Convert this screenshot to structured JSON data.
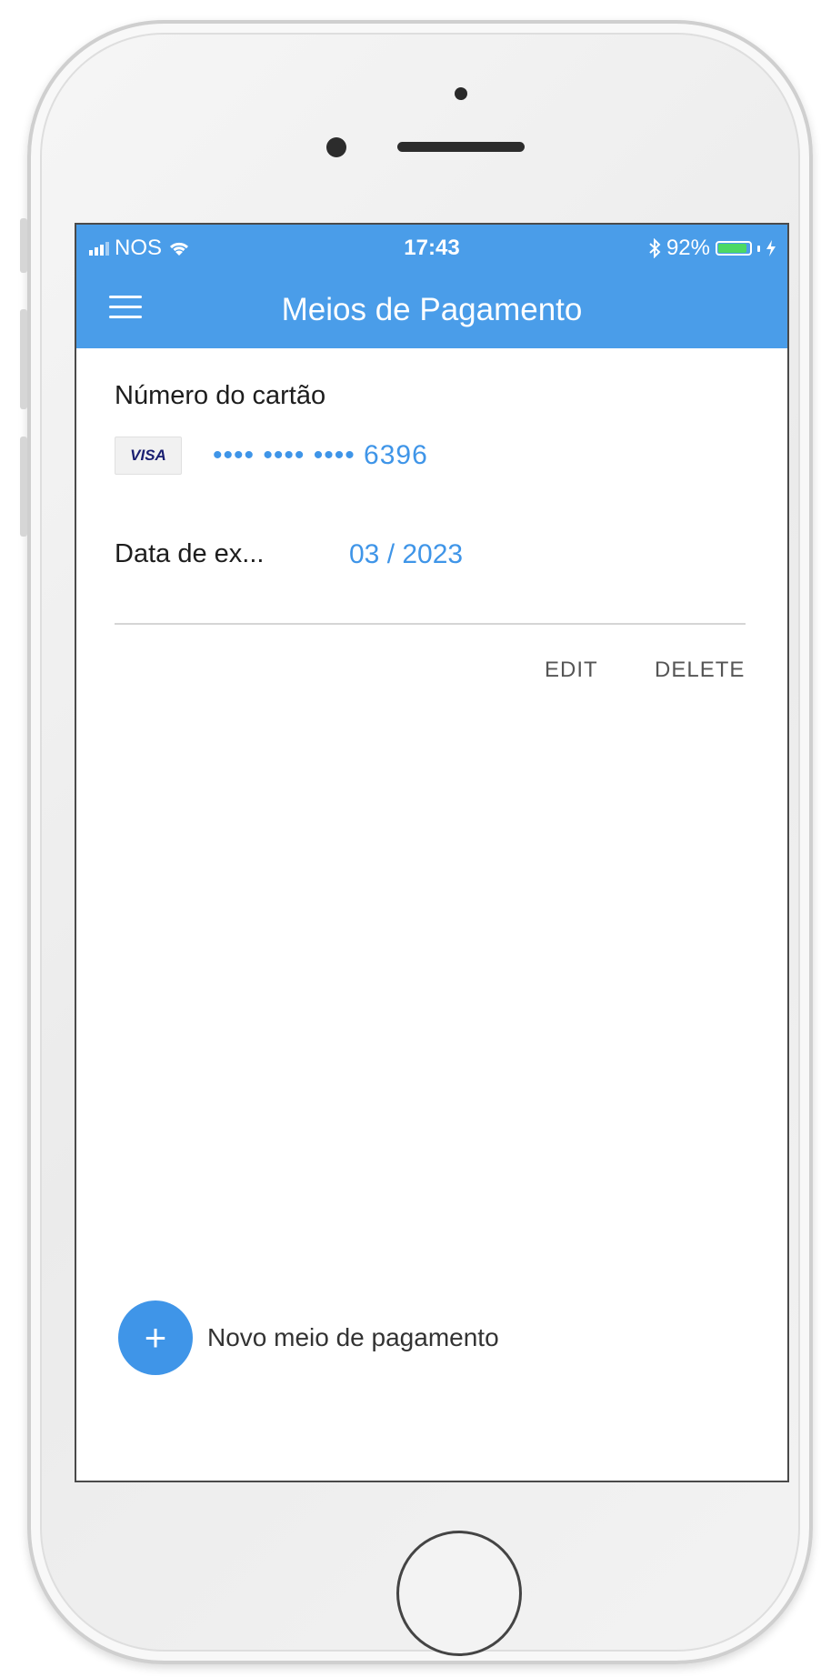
{
  "status_bar": {
    "carrier": "NOS",
    "time": "17:43",
    "battery_percent": "92%",
    "battery_level": 0.92,
    "icons": [
      "signal-icon",
      "wifi-icon",
      "bluetooth-icon",
      "battery-icon",
      "charging-icon"
    ]
  },
  "header": {
    "title": "Meios de Pagamento",
    "menu_icon": "hamburger-menu-icon",
    "color": "#4a9de9"
  },
  "card": {
    "number_label": "Número do cartão",
    "brand": "VISA",
    "masked_number": "•••• •••• •••• 6396",
    "expiry_label": "Data de ex...",
    "expiry_value": "03 / 2023"
  },
  "actions": {
    "edit": "EDIT",
    "delete": "DELETE"
  },
  "add_payment": {
    "icon": "+",
    "label": "Novo meio de pagamento"
  },
  "colors": {
    "accent": "#3f95e8",
    "header": "#4a9de9",
    "battery": "#4cd964"
  }
}
